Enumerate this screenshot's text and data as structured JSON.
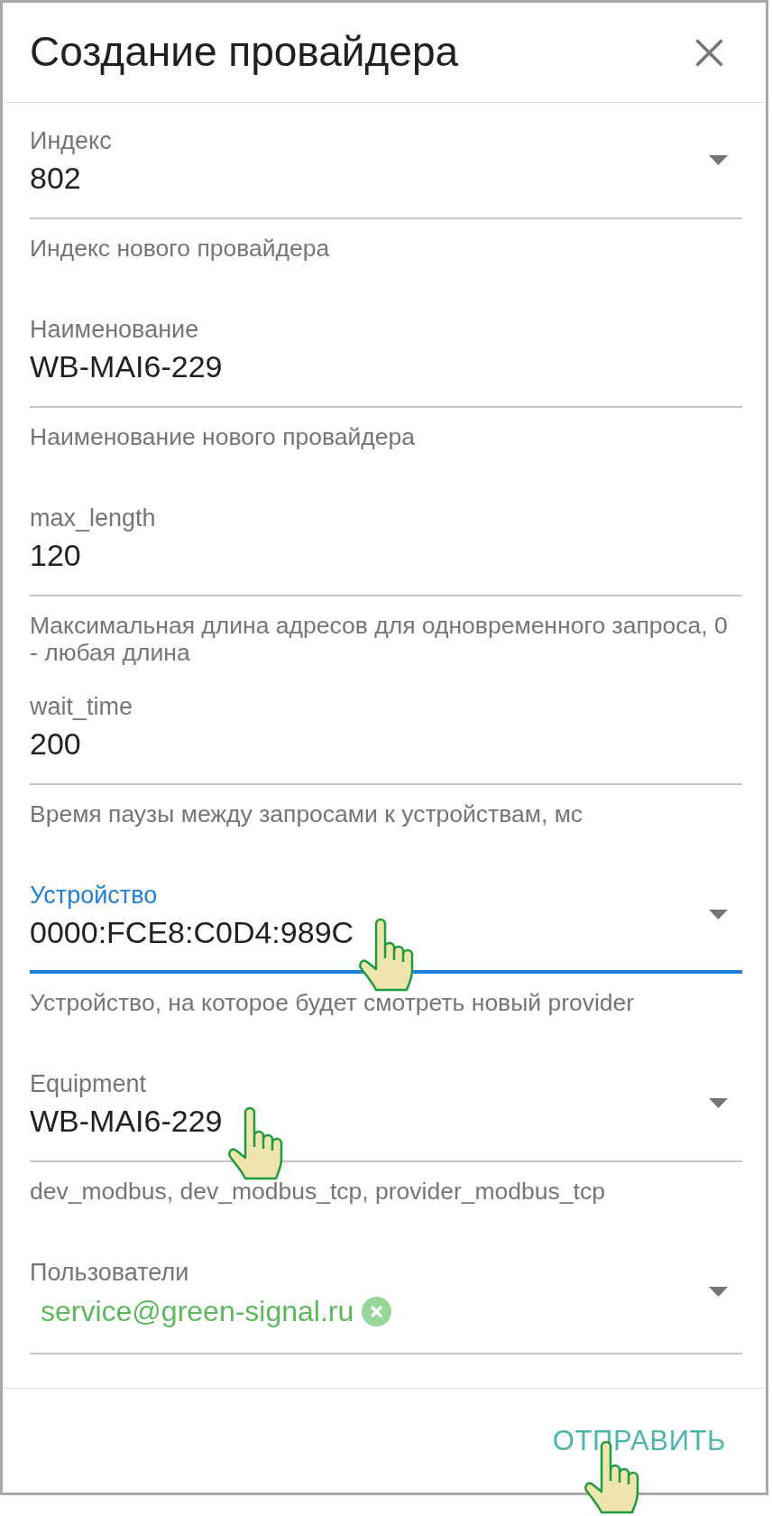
{
  "dialog": {
    "title": "Создание провайдера"
  },
  "fields": [
    {
      "kind": "select",
      "label": "Индекс",
      "value": "802",
      "helper": "Индекс нового провайдера",
      "focused": false
    },
    {
      "kind": "text",
      "label": "Наименование",
      "value": "WB-MAI6-229",
      "helper": "Наименование нового провайдера",
      "focused": false
    },
    {
      "kind": "text",
      "label": "max_length",
      "value": "120",
      "helper": "Максимальная длина адресов для одновременного запроса, 0 - любая длина",
      "focused": false
    },
    {
      "kind": "text",
      "label": "wait_time",
      "value": "200",
      "helper": "Время паузы между запросами к устройствам, мс",
      "focused": false
    },
    {
      "kind": "select",
      "label": "Устройство",
      "value": "0000:FCE8:C0D4:989C",
      "helper": "Устройство, на которое будет смотреть новый provider",
      "focused": true,
      "pointer": true
    },
    {
      "kind": "select",
      "label": "Equipment",
      "value": "WB-MAI6-229",
      "helper": "dev_modbus, dev_modbus_tcp, provider_modbus_tcp",
      "focused": false,
      "pointer": true
    },
    {
      "kind": "multiselect",
      "label": "Пользователи",
      "chips": [
        {
          "label": "service@green-signal.ru"
        }
      ],
      "focused": false
    }
  ],
  "actions": [
    {
      "label": "ОТПРАВИТЬ",
      "pointer": true
    }
  ]
}
